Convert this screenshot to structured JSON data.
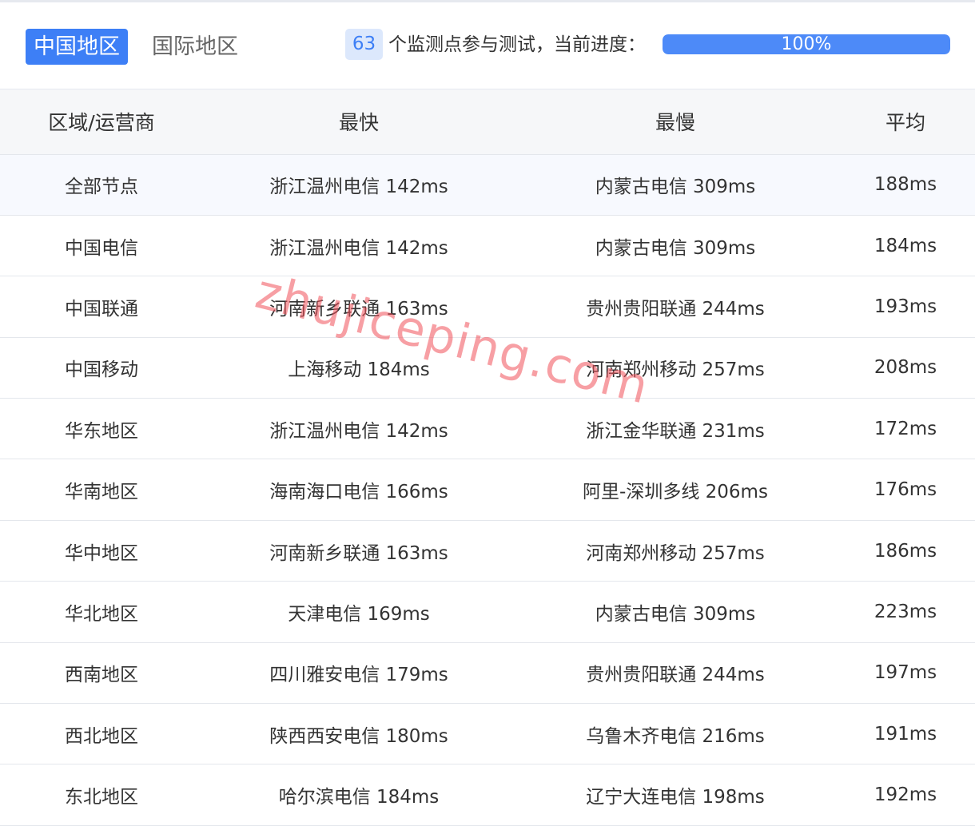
{
  "tabs": [
    {
      "label": "中国地区",
      "active": true
    },
    {
      "label": "国际地区",
      "active": false
    }
  ],
  "status": {
    "node_count": "63",
    "text": "个监测点参与测试，当前进度：",
    "progress_label": "100%",
    "progress_fraction": 1.0
  },
  "table": {
    "headers": [
      "区域/运营商",
      "最快",
      "最慢",
      "平均"
    ],
    "rows": [
      [
        "全部节点",
        "浙江温州电信 142ms",
        "内蒙古电信 309ms",
        "188ms"
      ],
      [
        "中国电信",
        "浙江温州电信 142ms",
        "内蒙古电信 309ms",
        "184ms"
      ],
      [
        "中国联通",
        "河南新乡联通 163ms",
        "贵州贵阳联通 244ms",
        "193ms"
      ],
      [
        "中国移动",
        "上海移动 184ms",
        "河南郑州移动 257ms",
        "208ms"
      ],
      [
        "华东地区",
        "浙江温州电信 142ms",
        "浙江金华联通 231ms",
        "172ms"
      ],
      [
        "华南地区",
        "海南海口电信 166ms",
        "阿里-深圳多线 206ms",
        "176ms"
      ],
      [
        "华中地区",
        "河南新乡联通 163ms",
        "河南郑州移动 257ms",
        "186ms"
      ],
      [
        "华北地区",
        "天津电信 169ms",
        "内蒙古电信 309ms",
        "223ms"
      ],
      [
        "西南地区",
        "四川雅安电信 179ms",
        "贵州贵阳联通 244ms",
        "197ms"
      ],
      [
        "西北地区",
        "陕西西安电信 180ms",
        "乌鲁木齐电信 216ms",
        "191ms"
      ],
      [
        "东北地区",
        "哈尔滨电信 184ms",
        "辽宁大连电信 198ms",
        "192ms"
      ]
    ]
  },
  "watermark": "zhujiceping.com",
  "colors": {
    "accent": "#3d7ff6",
    "badge_bg": "#dce8fc",
    "watermark": "#f0505a"
  }
}
